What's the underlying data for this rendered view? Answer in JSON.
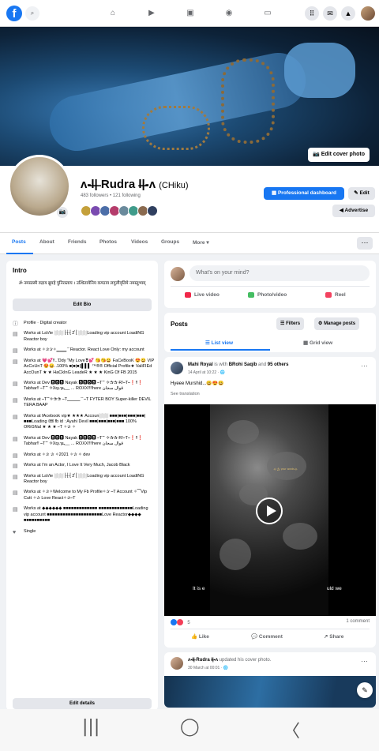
{
  "topbar": {
    "logo": "f",
    "icons": [
      "search-icon",
      "home-icon",
      "video-icon",
      "marketplace-icon",
      "groups-icon",
      "gaming-icon"
    ],
    "right_icons": [
      "menu-grid-icon",
      "messenger-icon",
      "notifications-icon"
    ]
  },
  "cover": {
    "edit_label": "Edit cover photo"
  },
  "profile": {
    "name": "ʌ-̶l̶|̶ Rudra l̶|̶-ʌ",
    "alt_name": "(CHiku)",
    "followers": "483 followers • 121 following",
    "friend_colors": [
      "#c4a03b",
      "#7a4bb0",
      "#4c6ea8",
      "#b53c6b",
      "#6a8a9c",
      "#3f9b8a",
      "#8a6a4f",
      "#2f3f5f"
    ],
    "buttons": {
      "dashboard": "Professional dashboard",
      "edit": "Edit",
      "advertise": "Advertise"
    }
  },
  "tabs": [
    "Posts",
    "About",
    "Friends",
    "Photos",
    "Videos",
    "Groups",
    "More ▾"
  ],
  "intro": {
    "title": "Intro",
    "bio": "ॐ नमस्तस्मै रुद्राय ब्रूमहे पुनिरस्ताय । उत्थितायेनिय कण्ठाय लगुलीवृतिमे नमस्तुभ्यम्‌",
    "edit_bio": "Edit Bio",
    "items": [
      {
        "icon": "info",
        "text": "Profile · Digital creator"
      },
      {
        "icon": "work",
        "text": "Works at LaVie ░░░ ɭ̊-ʈ̊-ʈ̊ 2̊ ɭ̊ ░░░Loading vip account LoadiNG Reactor boy"
      },
      {
        "icon": "work",
        "text": "Works at ✧✰✰✧▁▁▁ ̄ ̄ Reactor. React Love Only: my account"
      },
      {
        "icon": "work",
        "text": "Works at 💗💕‼..'Ddy \"My Love❣💕 😘😘😀 FaCeBooK 😍😀 VIP AcCoUnT 😍😀..100% ■|■|■||▌▌▌ ™®® Official Profile★ ValiFIEd AccOunT ★ ★ HaCkInG LeadeR ★ ★ ★ KinG Of FB 2015"
      },
      {
        "icon": "work",
        "text": "Works at Dev 🅱🅱🅱 Nayak 🅱🅱🅱🅱 ⎯T⁀ ✧✰✰ Ɍ!⎯T⎯❗‼❗ Tabhar‼ ⎯T⁀ ✧Xr̶y.ɿs̶,__ ... ROXX‼‼here قوال سجان"
      },
      {
        "icon": "work",
        "text": "Works at ⎯T⁀✧✰✰ ⎯T▁▁▁ ̄ ̄ ⎯T FYTER BOY Super-killer DEVIL TERA BAAP"
      },
      {
        "icon": "work",
        "text": "Works at fAcebook vip★ ★★★ Accoun░░░ ■■■|■■■|■■■|■■■|■■■Loading 🎟 fb id : Ayahi Devil ■■■|■■■|■■■|■■■ 100% ORiGNal ★ ★ ★ ⎯T ✧✰ ✧ "
      },
      {
        "icon": "work",
        "text": "Works at Dev 🅱🅱🅱 Nayak 🅱🅱🅱🅱 ⎯T⁀ ✧✰✰ Ɍ!⎯T⎯❗‼❗ Tabhar‼ ⎯T⁀ ✧Xr̶y.ɿs̶,__ ... ROXX‼‼here قوال سجان"
      },
      {
        "icon": "work",
        "text": "Works at ✧✰ ✰ ✧2021 ✧✰ ✧ dev"
      },
      {
        "icon": "work",
        "text": "Works at I'm an Actor, I Love It Very Much, Jacob Black"
      },
      {
        "icon": "work",
        "text": "Works at LaVie ░░░ ɭ̊-ʈ̊-ʈ̊ 2̊ ɭ̊ ░░░Loading vip account LoadiNG Reactor boy"
      },
      {
        "icon": "work",
        "text": "Works at ✧✰✧Welcome to My Fb Profile✧✰ ⎯T Account ✧⁀Vip Cutt ✧✰ Love React✧✰⎯T"
      },
      {
        "icon": "work",
        "text": "Works at ◆◆◆◆◆◆ ■■■■■■■■■■■■■ ■■■■■■■■■■■■■Loading vip account ■■■■■■■■■■■■■■■■■■■■■Love Reactor◆◆◆◆ ■■■■■■■■■■"
      },
      {
        "icon": "heart",
        "text": "Single"
      }
    ],
    "edit_details": "Edit details"
  },
  "composer": {
    "placeholder": "What's on your mind?",
    "actions": [
      "Live video",
      "Photo/video",
      "Reel"
    ]
  },
  "posts_header": {
    "title": "Posts",
    "filters": "Filters",
    "manage": "Manage posts",
    "list_view": "List view",
    "grid_view": "Grid view"
  },
  "post": {
    "author": "Mahi Royal",
    "with": "is with",
    "tagged": "BRohi Saqib",
    "and": "and",
    "others": "95 others",
    "time": "14 April at 10:22 · 🌐",
    "text": "Hyeee Murshid...😀😍😀",
    "see_translation": "See translation",
    "caption_left": "It is e",
    "caption_right": "uld we",
    "gold": "✧✰ ᵞᵒᵘʳ ʷᵒʳᵈˢ✧",
    "reactions_count": "5",
    "comments": "1 comment",
    "actions": [
      "Like",
      "Comment",
      "Share"
    ]
  },
  "post2": {
    "author": "ʌ-̶l̶|̶ Rudra l̶|̶-ʌ",
    "action": "updated his cover photo.",
    "time": "30 March at 00:01 · 🌐"
  },
  "navbar": {
    "recent": "|||",
    "home": "◯",
    "back": "〈"
  }
}
